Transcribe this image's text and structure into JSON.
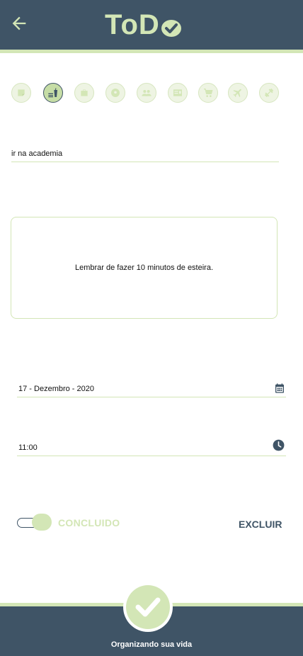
{
  "app": {
    "logo_text": "ToD"
  },
  "colors": {
    "primary": "#3f5466",
    "accent": "#d3e6b6",
    "background": "#ffffff"
  },
  "categories": [
    {
      "icon": "note-icon",
      "selected": false
    },
    {
      "icon": "food-drink-icon",
      "selected": true
    },
    {
      "icon": "briefcase-icon",
      "selected": false
    },
    {
      "icon": "soccer-ball-icon",
      "selected": false
    },
    {
      "icon": "people-icon",
      "selected": false
    },
    {
      "icon": "newspaper-icon",
      "selected": false
    },
    {
      "icon": "shopping-cart-icon",
      "selected": false
    },
    {
      "icon": "airplane-icon",
      "selected": false
    },
    {
      "icon": "fitness-icon",
      "selected": false
    }
  ],
  "task": {
    "title": "ir na academia",
    "description": "Lembrar de fazer 10 minutos de esteira.",
    "date": "17 - Dezembro - 2020",
    "time": "11:00",
    "done": true
  },
  "labels": {
    "concluido": "CONCLUIDO",
    "excluir": "EXCLUIR"
  },
  "footer": {
    "tagline": "Organizando sua vida"
  }
}
